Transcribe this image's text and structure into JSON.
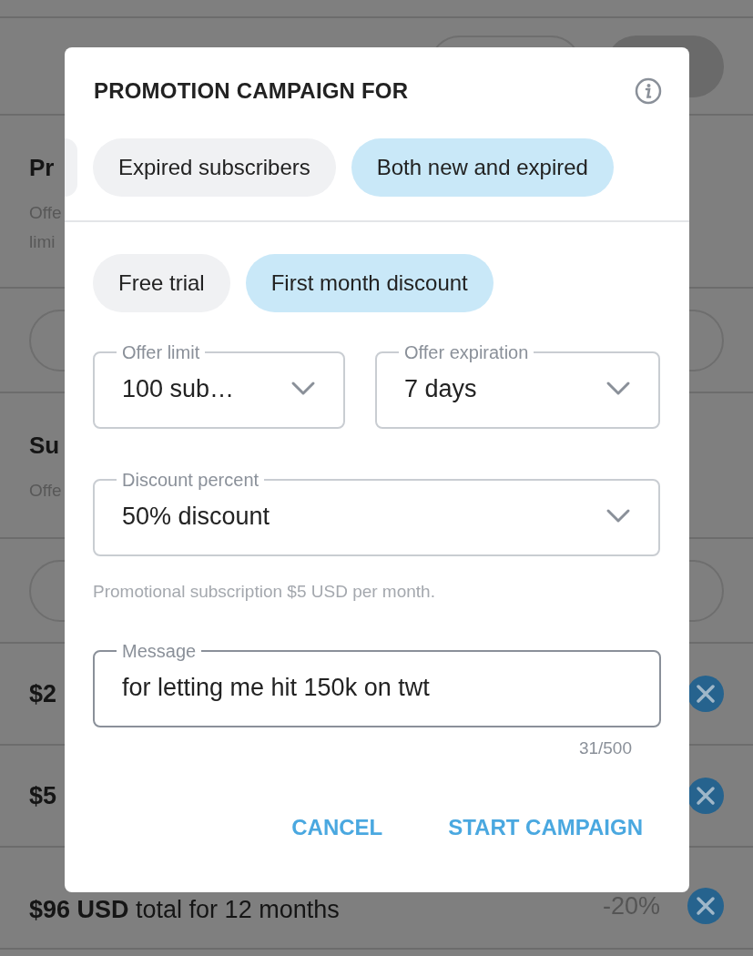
{
  "background": {
    "sections": [
      {
        "title": "Pr",
        "description": [
          "Offe",
          "limi"
        ]
      },
      {
        "title": "Su",
        "description": [
          "Offe"
        ]
      }
    ],
    "offers": [
      {
        "price": "**$2**"
      },
      {
        "price": "**$5**"
      },
      {
        "price": "**$96 USD** total for 12 months",
        "discount": "-20%"
      }
    ]
  },
  "dialog": {
    "title": "PROMOTION CAMPAIGN FOR",
    "audience_chips": [
      {
        "label": "Expired subscribers",
        "selected": false
      },
      {
        "label": "Both new and expired",
        "selected": true
      }
    ],
    "offer_type_chips": [
      {
        "label": "Free trial",
        "selected": false
      },
      {
        "label": "First month discount",
        "selected": true
      }
    ],
    "fields": [
      {
        "kind": "select",
        "label": "Offer limit",
        "value": "100 sub…"
      },
      {
        "kind": "select",
        "label": "Offer expiration",
        "value": "7 days"
      },
      {
        "kind": "select",
        "label": "Discount percent",
        "value": "50% discount"
      }
    ],
    "hint": "Promotional subscription $5 USD per month.",
    "message": {
      "kind": "text",
      "label": "Message",
      "value": "for letting me hit 150k on twt"
    },
    "counter": "31/500",
    "buttons": [
      "CANCEL",
      "START CAMPAIGN"
    ]
  }
}
